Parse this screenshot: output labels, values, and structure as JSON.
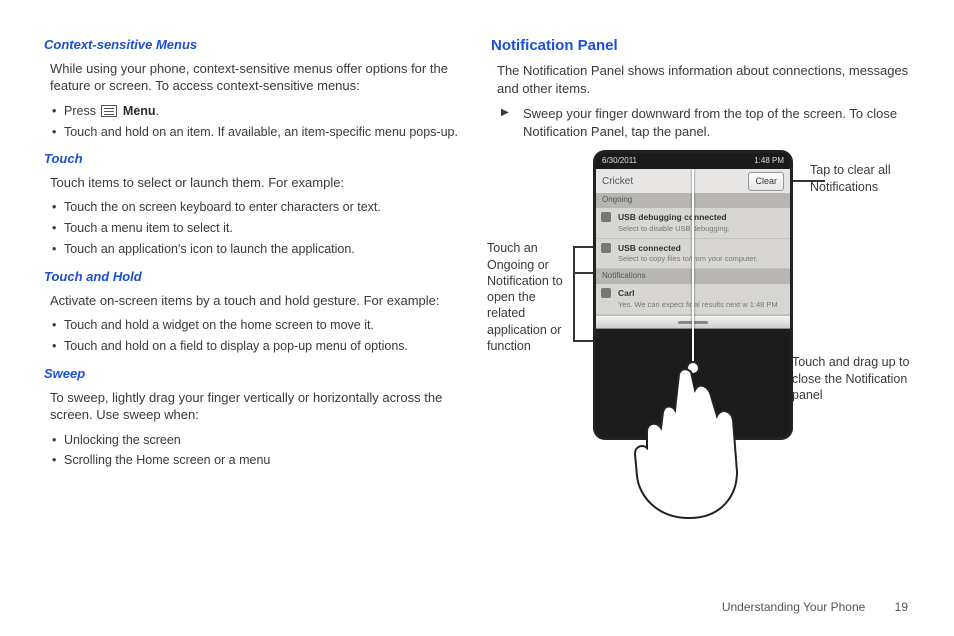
{
  "left": {
    "h_context": "Context-sensitive Menus",
    "p_context": "While using your phone, context-sensitive menus offer options for the feature or screen. To access context-sensitive menus:",
    "li_press_prefix": "Press ",
    "li_press_menu": "Menu",
    "li_press_suffix": ".",
    "li_hold": "Touch and hold on an item. If available, an item-specific menu pops-up.",
    "h_touch": "Touch",
    "p_touch": "Touch items to select or launch them. For example:",
    "touch_items": [
      "Touch the on screen keyboard to enter characters or text.",
      "Touch a menu item to select it.",
      "Touch an application's icon to launch the application."
    ],
    "h_touchhold": "Touch and Hold",
    "p_touchhold": "Activate on-screen items by a touch and hold gesture. For example:",
    "touchhold_items": [
      "Touch and hold a widget on the home screen to move it.",
      "Touch and hold on a field to display a pop-up menu of options."
    ],
    "h_sweep": "Sweep",
    "p_sweep": "To sweep, lightly drag your finger vertically or horizontally across the screen. Use sweep when:",
    "sweep_items": [
      "Unlocking the screen",
      "Scrolling the Home screen or a menu"
    ]
  },
  "right": {
    "h_notif": "Notification Panel",
    "p_notif": "The Notification Panel shows information about connections, messages and other items.",
    "arrow_item": "Sweep your finger downward from the top of the screen. To close Notification Panel, tap the panel.",
    "call_left": "Touch an Ongoing or Notification to open the related application or function",
    "call_tr": "Tap to clear all Notifications",
    "call_br": "Touch and drag up to close the Notification panel",
    "phone": {
      "status_date": "6/30/2011",
      "status_time": "1:48 PM",
      "carrier": "Cricket",
      "clear": "Clear",
      "ongoing_label": "Ongoing",
      "notif_label": "Notifications",
      "items_ongoing": [
        {
          "t": "USB debugging connected",
          "s": "Select to disable USB debugging."
        },
        {
          "t": "USB connected",
          "s": "Select to copy files to/from your computer."
        }
      ],
      "items_notif": [
        {
          "t": "Carl",
          "s": "Yes. We can expect final results next w  1:48 PM"
        }
      ]
    }
  },
  "footer": {
    "chapter": "Understanding Your Phone",
    "page": "19"
  }
}
